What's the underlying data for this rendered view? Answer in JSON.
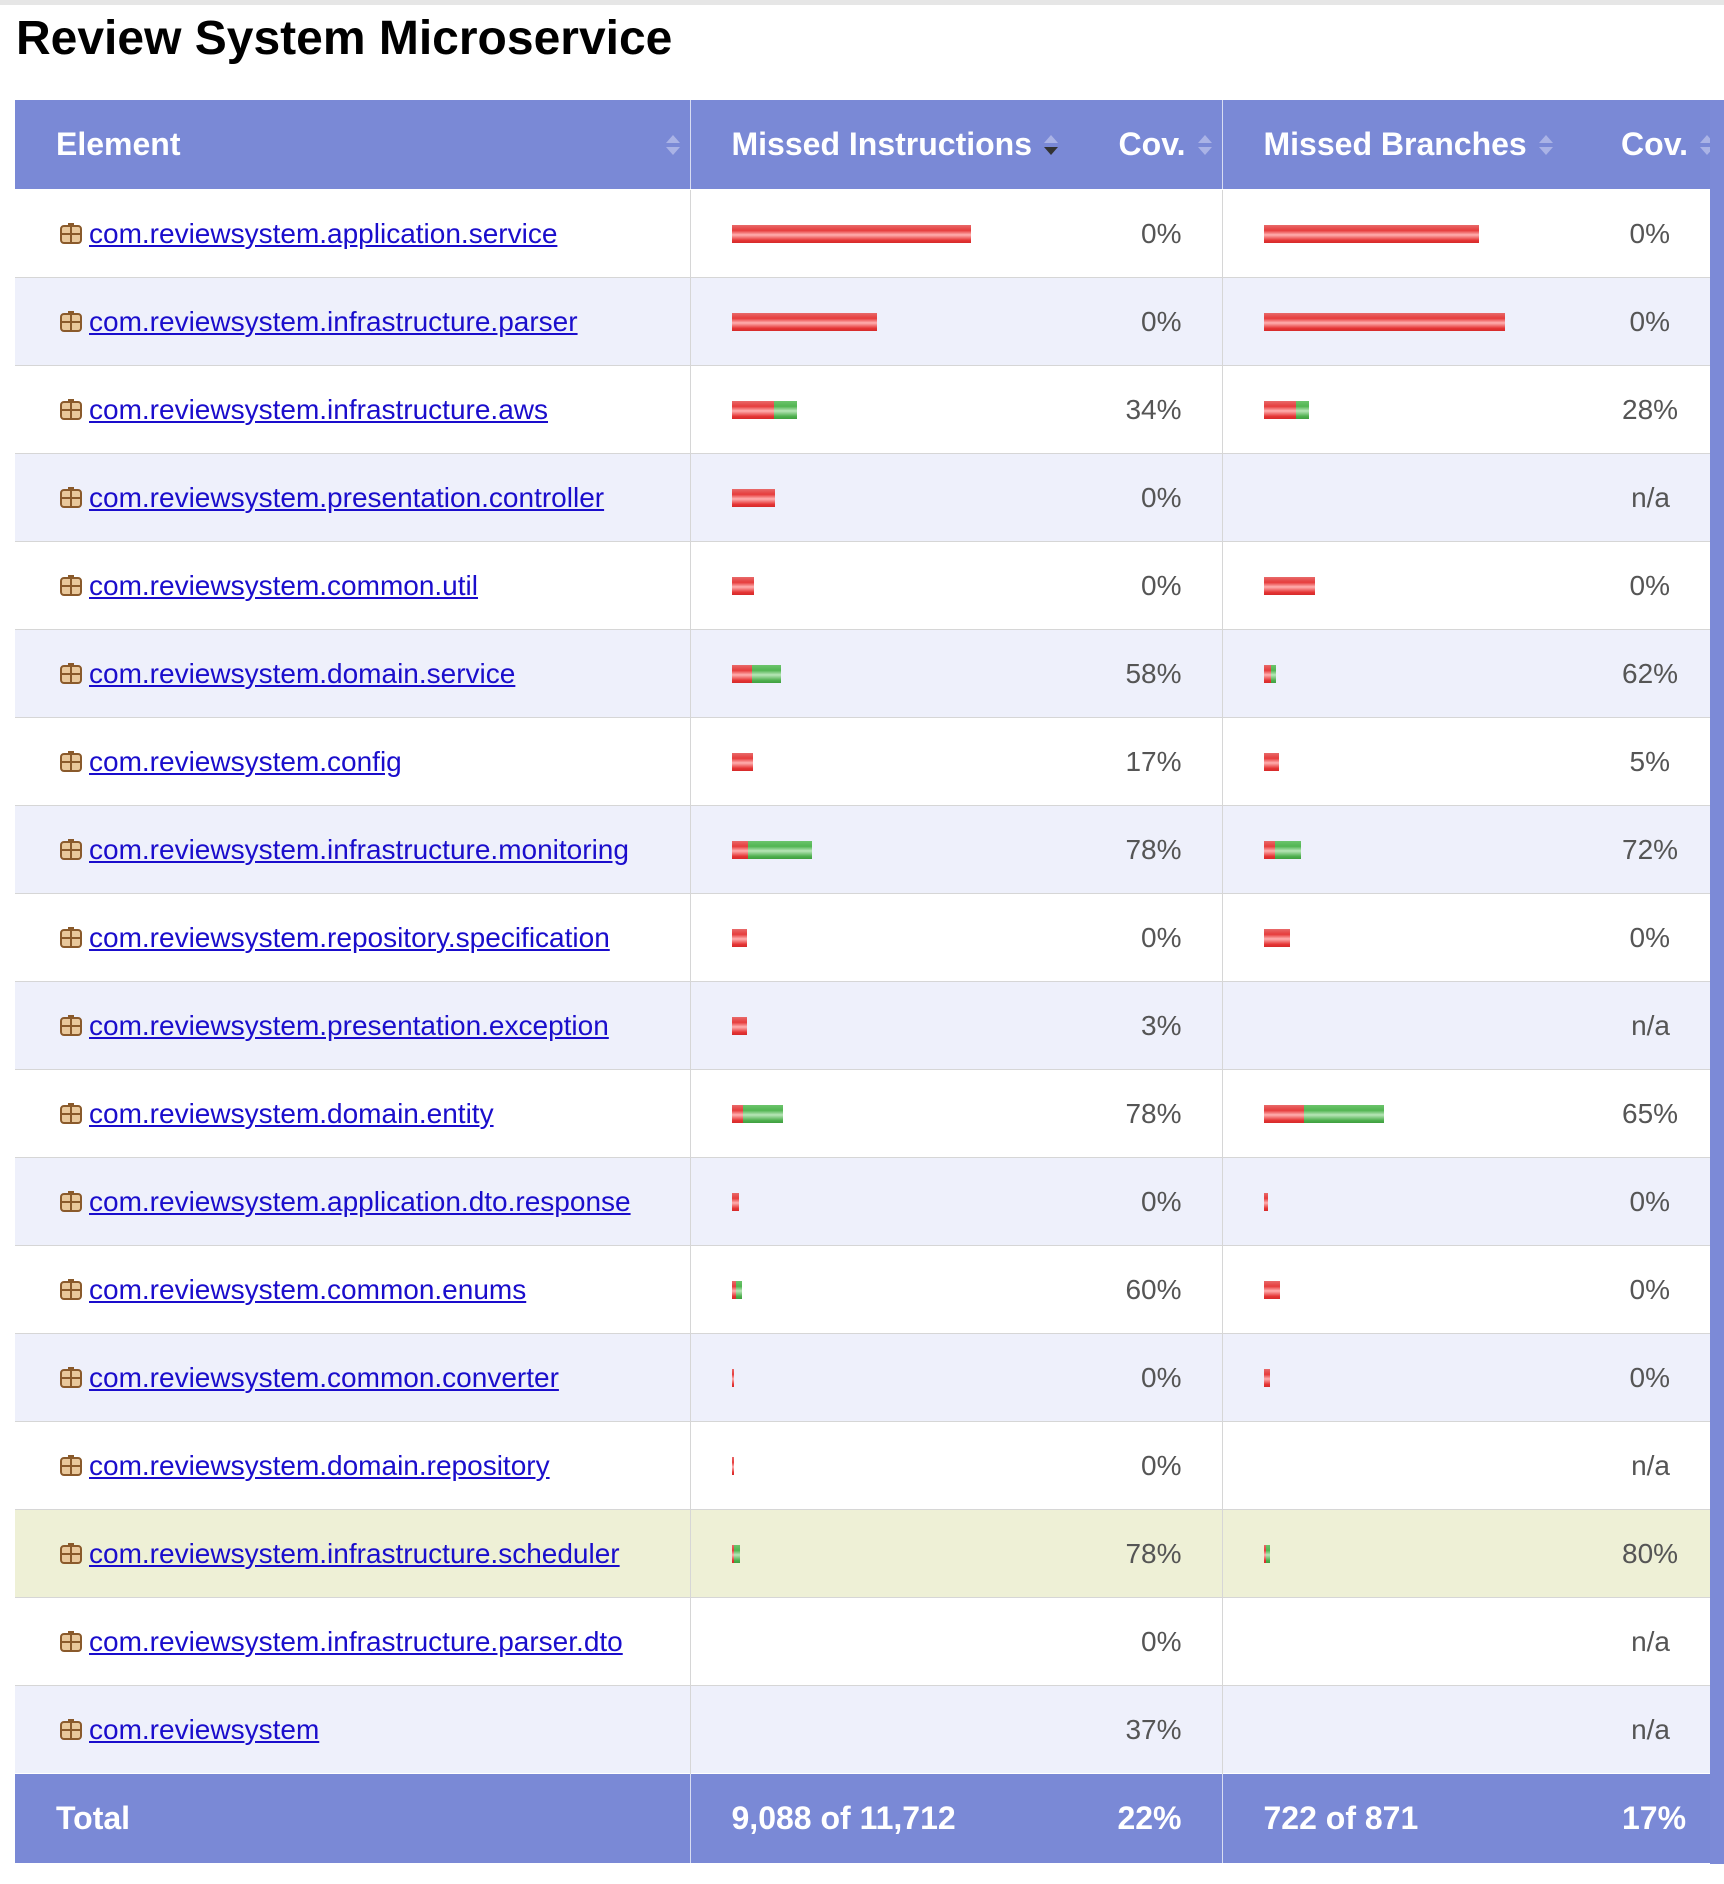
{
  "page": {
    "title": "Review System Microservice"
  },
  "table": {
    "headers": {
      "element": "Element",
      "missed_instructions": "Missed Instructions",
      "instr_cov": "Cov.",
      "missed_branches": "Missed Branches",
      "branch_cov": "Cov."
    },
    "max_instr_bar_fraction": 1.0,
    "rows": [
      {
        "name": "com.reviewsystem.application.service",
        "instr_red": 0.292,
        "instr_green": 0.0,
        "instr_cov": "0%",
        "br_red": 0.262,
        "br_green": 0.0,
        "br_cov": "0%"
      },
      {
        "name": "com.reviewsystem.infrastructure.parser",
        "instr_red": 0.177,
        "instr_green": 0.0,
        "instr_cov": "0%",
        "br_red": 0.294,
        "br_green": 0.0,
        "br_cov": "0%"
      },
      {
        "name": "com.reviewsystem.infrastructure.aws",
        "instr_red": 0.051,
        "instr_green": 0.028,
        "instr_cov": "34%",
        "br_red": 0.039,
        "br_green": 0.016,
        "br_cov": "28%"
      },
      {
        "name": "com.reviewsystem.presentation.controller",
        "instr_red": 0.052,
        "instr_green": 0.0,
        "instr_cov": "0%",
        "br_red": 0.0,
        "br_green": 0.0,
        "br_cov": "n/a"
      },
      {
        "name": "com.reviewsystem.common.util",
        "instr_red": 0.027,
        "instr_green": 0.0,
        "instr_cov": "0%",
        "br_red": 0.062,
        "br_green": 0.0,
        "br_cov": "0%"
      },
      {
        "name": "com.reviewsystem.domain.service",
        "instr_red": 0.024,
        "instr_green": 0.035,
        "instr_cov": "58%",
        "br_red": 0.009,
        "br_green": 0.006,
        "br_cov": "62%"
      },
      {
        "name": "com.reviewsystem.config",
        "instr_red": 0.025,
        "instr_green": 0.0,
        "instr_cov": "17%",
        "br_red": 0.018,
        "br_green": 0.0,
        "br_cov": "5%"
      },
      {
        "name": "com.reviewsystem.infrastructure.monitoring",
        "instr_red": 0.02,
        "instr_green": 0.078,
        "instr_cov": "78%",
        "br_red": 0.013,
        "br_green": 0.032,
        "br_cov": "72%"
      },
      {
        "name": "com.reviewsystem.repository.specification",
        "instr_red": 0.018,
        "instr_green": 0.0,
        "instr_cov": "0%",
        "br_red": 0.032,
        "br_green": 0.0,
        "br_cov": "0%"
      },
      {
        "name": "com.reviewsystem.presentation.exception",
        "instr_red": 0.018,
        "instr_green": 0.0,
        "instr_cov": "3%",
        "br_red": 0.0,
        "br_green": 0.0,
        "br_cov": "n/a"
      },
      {
        "name": "com.reviewsystem.domain.entity",
        "instr_red": 0.013,
        "instr_green": 0.049,
        "instr_cov": "78%",
        "br_red": 0.049,
        "br_green": 0.098,
        "br_cov": "65%"
      },
      {
        "name": "com.reviewsystem.application.dto.response",
        "instr_red": 0.009,
        "instr_green": 0.0,
        "instr_cov": "0%",
        "br_red": 0.005,
        "br_green": 0.0,
        "br_cov": "0%"
      },
      {
        "name": "com.reviewsystem.common.enums",
        "instr_red": 0.005,
        "instr_green": 0.007,
        "instr_cov": "60%",
        "br_red": 0.019,
        "br_green": 0.0,
        "br_cov": "0%"
      },
      {
        "name": "com.reviewsystem.common.converter",
        "instr_red": 0.003,
        "instr_green": 0.0,
        "instr_cov": "0%",
        "br_red": 0.007,
        "br_green": 0.0,
        "br_cov": "0%"
      },
      {
        "name": "com.reviewsystem.domain.repository",
        "instr_red": 0.003,
        "instr_green": 0.0,
        "instr_cov": "0%",
        "br_red": 0.0,
        "br_green": 0.0,
        "br_cov": "n/a"
      },
      {
        "name": "com.reviewsystem.infrastructure.scheduler",
        "instr_red": 0.003,
        "instr_green": 0.007,
        "instr_cov": "78%",
        "br_red": 0.002,
        "br_green": 0.005,
        "br_cov": "80%",
        "highlight": true
      },
      {
        "name": "com.reviewsystem.infrastructure.parser.dto",
        "instr_red": 0.0,
        "instr_green": 0.0,
        "instr_cov": "0%",
        "br_red": 0.0,
        "br_green": 0.0,
        "br_cov": "n/a"
      },
      {
        "name": "com.reviewsystem",
        "instr_red": 0.0,
        "instr_green": 0.0,
        "instr_cov": "37%",
        "br_red": 0.0,
        "br_green": 0.0,
        "br_cov": "n/a"
      }
    ],
    "footer": {
      "label": "Total",
      "missed_instructions": "9,088 of 11,712",
      "instr_cov": "22%",
      "missed_branches": "722 of 871",
      "branch_cov": "17%"
    }
  },
  "colors": {
    "header_bg": "#7a89d6",
    "link": "#1a0dcc",
    "missed": "#e63c3c",
    "covered": "#52b552",
    "alt_row": "#eef0fb",
    "highlight_row": "#eef0d6"
  }
}
